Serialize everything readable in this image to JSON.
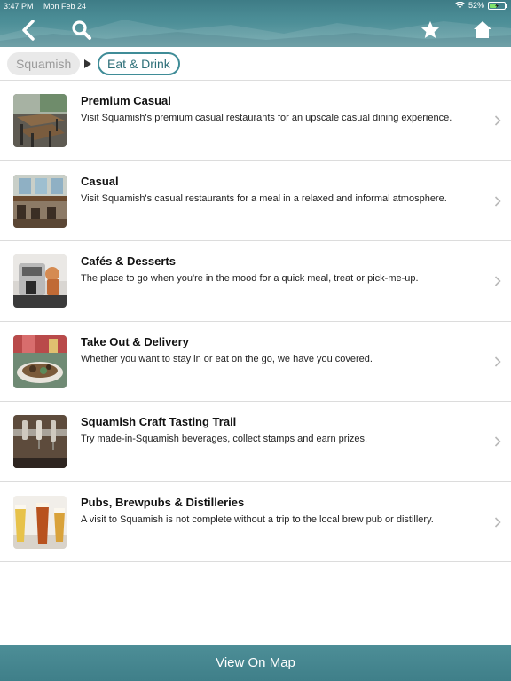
{
  "status_bar": {
    "time": "3:47 PM",
    "date": "Mon Feb 24",
    "battery": "52%",
    "battery_level": 0.52
  },
  "header": {
    "icons": [
      "back-arrow-icon",
      "search-icon",
      "star-icon",
      "home-icon"
    ]
  },
  "breadcrumb": {
    "home": "Squamish",
    "current": "Eat & Drink"
  },
  "items": [
    {
      "title": "Premium Casual",
      "description": "Visit Squamish's premium casual restaurants for an upscale casual dining experience.",
      "thumb": "restaurant-patio-photo"
    },
    {
      "title": "Casual",
      "description": "Visit Squamish's casual restaurants for a meal in a relaxed and informal atmosphere.",
      "thumb": "dining-room-photo"
    },
    {
      "title": "Cafés & Desserts",
      "description": "The place to go when you're in the mood for a quick meal, treat or pick-me-up.",
      "thumb": "espresso-machine-photo"
    },
    {
      "title": "Take Out & Delivery",
      "description": "Whether you want to stay in or eat on the go, we have you covered.",
      "thumb": "takeout-food-photo"
    },
    {
      "title": "Squamish Craft Tasting Trail",
      "description": "Try made-in-Squamish beverages, collect stamps and earn prizes.",
      "thumb": "beer-tap-photo"
    },
    {
      "title": "Pubs, Brewpubs & Distilleries",
      "description": "A visit to Squamish is not complete without a trip to the local brew pub or distillery.",
      "thumb": "beer-glasses-photo"
    }
  ],
  "footer": {
    "label": "View On Map"
  },
  "colors": {
    "header": "#4b8d96",
    "accent": "#3f8c97",
    "footer": "#46878f"
  }
}
